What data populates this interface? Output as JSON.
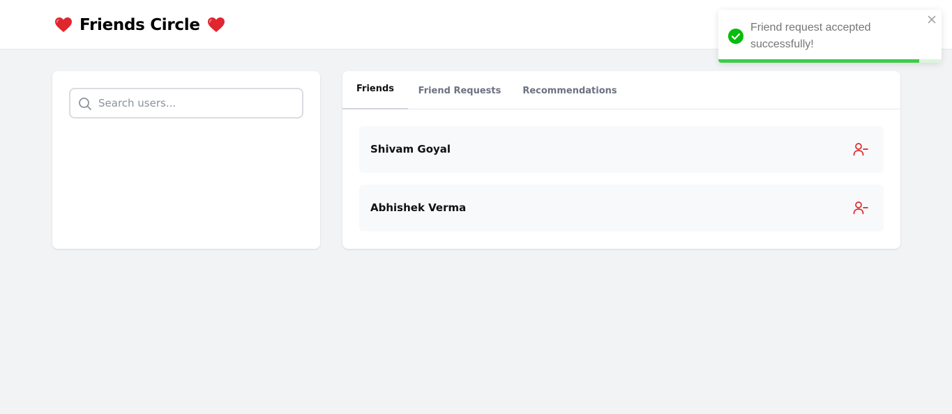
{
  "header": {
    "title": "Friends Circle",
    "left_icon": "heart-icon",
    "right_icon": "heart-icon"
  },
  "search": {
    "placeholder": "Search users...",
    "value": "",
    "icon": "search-icon"
  },
  "tabs": [
    {
      "label": "Friends",
      "active": true
    },
    {
      "label": "Friend Requests",
      "active": false
    },
    {
      "label": "Recommendations",
      "active": false
    }
  ],
  "friends": [
    {
      "name": "Shivam Goyal",
      "action_icon": "remove-friend-icon"
    },
    {
      "name": "Abhishek Verma",
      "action_icon": "remove-friend-icon"
    }
  ],
  "toast": {
    "message": "Friend request accepted successfully!",
    "status": "success",
    "icon": "check-circle-icon",
    "close_icon": "close-icon",
    "progress": 0.9
  },
  "colors": {
    "background": "#f2f3f5",
    "heart": "#e0262f",
    "remove_action": "#dc2626",
    "toast_success": "#07bc0c",
    "toast_progress": "#3dcc48"
  }
}
